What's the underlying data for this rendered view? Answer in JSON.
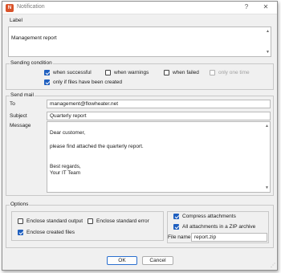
{
  "window": {
    "title": "Notification",
    "help_glyph": "?",
    "close_glyph": "✕",
    "icon_text": "N"
  },
  "label_section": {
    "title": "Label",
    "value": "Management report"
  },
  "sending_condition": {
    "title": "Sending condition",
    "options": [
      {
        "label": "when successful",
        "checked": true,
        "enabled": true
      },
      {
        "label": "when warnings",
        "checked": false,
        "enabled": true
      },
      {
        "label": "when failed",
        "checked": false,
        "enabled": true
      },
      {
        "label": "only one time",
        "checked": false,
        "enabled": false
      },
      {
        "label": "only if files have been created",
        "checked": true,
        "enabled": true
      }
    ]
  },
  "send_mail": {
    "title": "Send mail",
    "to_label": "To",
    "to_value": "management@flowheater.net",
    "subject_label": "Subject",
    "subject_value": "Quarterly report",
    "message_label": "Message",
    "message_value": "Dear customer,\n\nplease find attached the quarterly report.\n\n\nBest regards,\nYour IT Team"
  },
  "options": {
    "title": "Options",
    "enclose_standard_output": {
      "label": "Enclose standard output",
      "checked": false
    },
    "enclose_standard_error": {
      "label": "Enclose standard error",
      "checked": false
    },
    "enclose_created_files": {
      "label": "Enclose created files",
      "checked": true
    },
    "compress_attachments": {
      "label": "Compress attachments",
      "checked": true
    },
    "all_in_zip": {
      "label": "All attachments in a ZIP archive",
      "checked": true
    },
    "file_name_label": "File name",
    "file_name_value": "report.zip"
  },
  "buttons": {
    "ok": "OK",
    "cancel": "Cancel"
  },
  "colors": {
    "accent": "#1f5fbf",
    "app_icon": "#d9532a"
  }
}
